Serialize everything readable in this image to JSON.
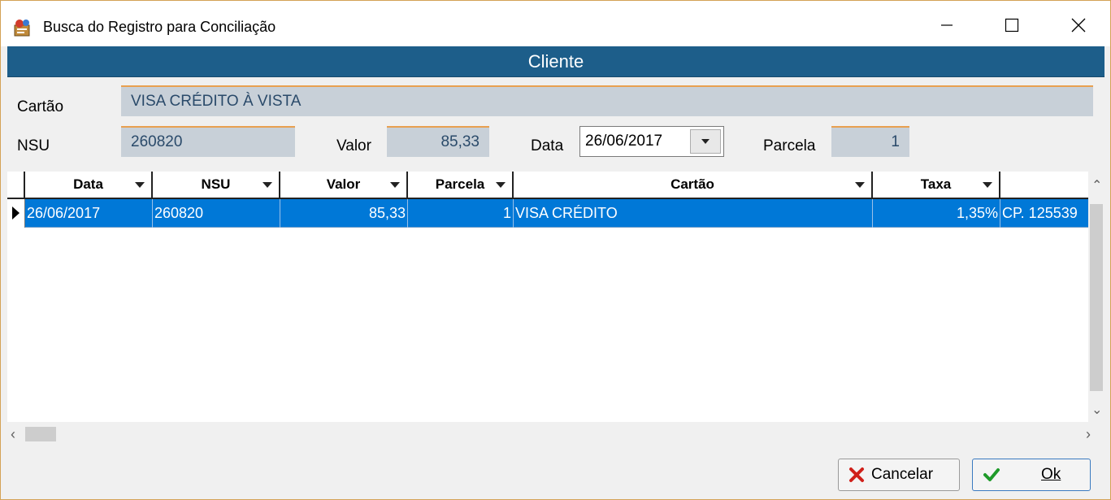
{
  "window": {
    "title": "Busca do Registro para Conciliação",
    "controls": {
      "minimize": "minimize",
      "maximize": "maximize",
      "close": "close"
    }
  },
  "header": {
    "title": "Cliente"
  },
  "form": {
    "cartao_label": "Cartão",
    "cartao_value": "VISA CRÉDITO À VISTA",
    "nsu_label": "NSU",
    "nsu_value": "260820",
    "valor_label": "Valor",
    "valor_value": "85,33",
    "data_label": "Data",
    "data_value": "26/06/2017",
    "parcela_label": "Parcela",
    "parcela_value": "1"
  },
  "grid": {
    "columns": [
      "Data",
      "NSU",
      "Valor",
      "Parcela",
      "Cartão",
      "Taxa"
    ],
    "rows": [
      {
        "data": "26/06/2017",
        "nsu": "260820",
        "valor": "85,33",
        "parcela": "1",
        "cartao": "VISA CRÉDITO",
        "taxa": "1,35%",
        "extra": "CP. 125539"
      }
    ]
  },
  "buttons": {
    "cancel_label": "Cancelar",
    "ok_label": "Ok"
  },
  "colors": {
    "header_band": "#1d5e8a",
    "selected_row": "#0078d7",
    "readonly_field": "#c8d0d8",
    "field_accent": "#e8a050"
  },
  "icons": {
    "app": "app-icon",
    "cancel": "x-icon",
    "ok": "checkmark-icon"
  }
}
